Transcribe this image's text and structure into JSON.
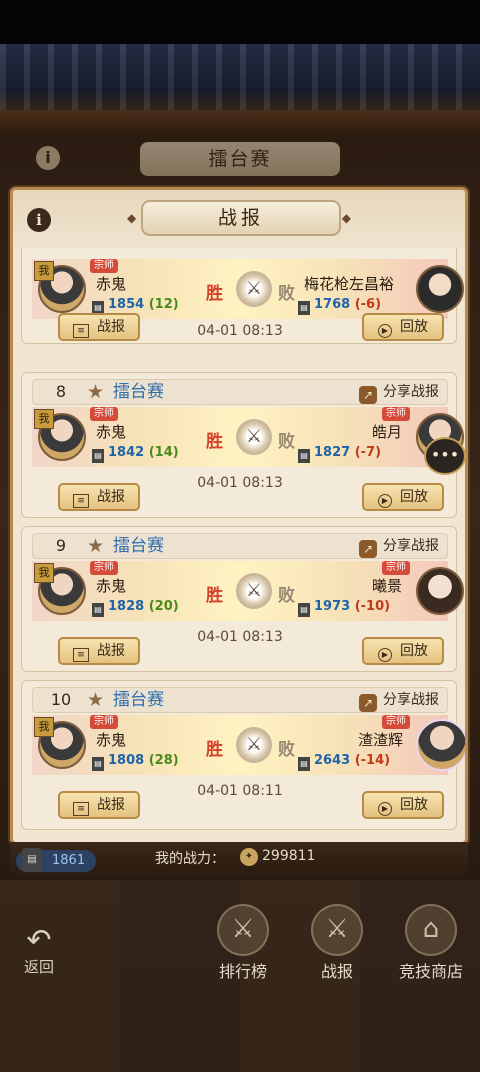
{
  "window": {
    "outer_title": "擂台赛",
    "panel_title": "战报",
    "info_symbol": "i"
  },
  "records": [
    {
      "index": "",
      "mode": "",
      "share_label": "",
      "left": {
        "me_tag": "我",
        "rank": "宗师",
        "name": "赤鬼",
        "rating": "1854",
        "delta": "(12)",
        "result": "胜"
      },
      "right": {
        "rank": "",
        "name": "梅花枪左昌裕",
        "rating": "1768",
        "delta": "(-6)",
        "result": "败"
      },
      "time": "04-01 08:13",
      "report_btn": "战报",
      "replay_btn": "回放"
    },
    {
      "index": "8",
      "mode": "擂台赛",
      "share_label": "分享战报",
      "left": {
        "me_tag": "我",
        "rank": "宗师",
        "name": "赤鬼",
        "rating": "1842",
        "delta": "(14)",
        "result": "胜"
      },
      "right": {
        "rank": "宗师",
        "name": "皓月",
        "rating": "1827",
        "delta": "(-7)",
        "result": "败"
      },
      "time": "04-01 08:13",
      "report_btn": "战报",
      "replay_btn": "回放"
    },
    {
      "index": "9",
      "mode": "擂台赛",
      "share_label": "分享战报",
      "left": {
        "me_tag": "我",
        "rank": "宗师",
        "name": "赤鬼",
        "rating": "1828",
        "delta": "(20)",
        "result": "胜"
      },
      "right": {
        "rank": "宗师",
        "name": "曦景",
        "rating": "1973",
        "delta": "(-10)",
        "result": "败"
      },
      "time": "04-01 08:13",
      "report_btn": "战报",
      "replay_btn": "回放"
    },
    {
      "index": "10",
      "mode": "擂台赛",
      "share_label": "分享战报",
      "left": {
        "me_tag": "我",
        "rank": "宗师",
        "name": "赤鬼",
        "rating": "1808",
        "delta": "(28)",
        "result": "胜"
      },
      "right": {
        "rank": "宗师",
        "name": "渣渣辉",
        "rating": "2643",
        "delta": "(-14)",
        "result": "败"
      },
      "time": "04-01 08:11",
      "report_btn": "战报",
      "replay_btn": "回放"
    }
  ],
  "footer": {
    "rating": "1861",
    "power_label": "我的战力：",
    "power_value": "299811"
  },
  "nav": {
    "back": "返回",
    "leaderboard": "排行榜",
    "reports": "战报",
    "shop": "竞技商店"
  },
  "colors": {
    "win": "#d6402a",
    "rating": "#1f63a8",
    "mode": "#2f6fb1",
    "panel_border": "#b78b52"
  }
}
